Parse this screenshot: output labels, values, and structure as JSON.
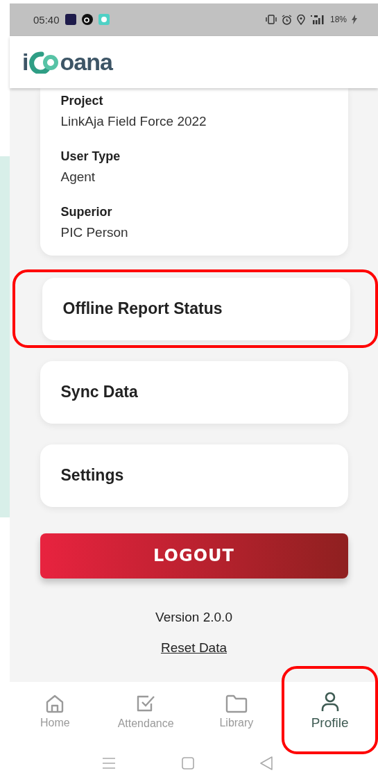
{
  "status_bar": {
    "time": "05:40",
    "battery": "18%"
  },
  "logo": {
    "lead": "i",
    "tail": "oana"
  },
  "profile_fields": [
    {
      "label": "Project",
      "value": "LinkAja Field Force 2022"
    },
    {
      "label": "User Type",
      "value": "Agent"
    },
    {
      "label": "Superior",
      "value": "PIC Person"
    }
  ],
  "menu": [
    {
      "label": "Offline Report Status",
      "highlighted": true
    },
    {
      "label": "Sync Data",
      "highlighted": false
    },
    {
      "label": "Settings",
      "highlighted": false
    }
  ],
  "logout_button": "LOGOUT",
  "version": "Version 2.0.0",
  "reset_link": "Reset Data",
  "bottom_nav": [
    {
      "label": "Home",
      "kind": "home",
      "selected": false,
      "highlighted": false
    },
    {
      "label": "Attendance",
      "kind": "attendance",
      "selected": false,
      "highlighted": false
    },
    {
      "label": "Library",
      "kind": "library",
      "selected": false,
      "highlighted": false
    },
    {
      "label": "Profile",
      "kind": "profile",
      "selected": true,
      "highlighted": true
    }
  ]
}
